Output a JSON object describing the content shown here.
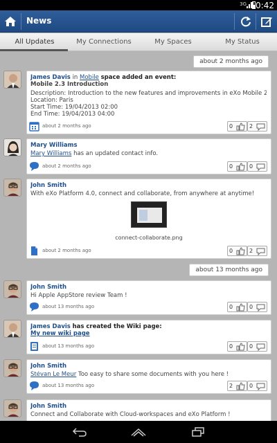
{
  "status_bar": {
    "signal": "3G",
    "time": "10:42"
  },
  "action_bar": {
    "title": "News"
  },
  "tabs": [
    {
      "label": "All Updates",
      "active": true
    },
    {
      "label": "My Connections"
    },
    {
      "label": "My Spaces"
    },
    {
      "label": "My Status"
    }
  ],
  "groups": [
    {
      "header": "about 2 months ago"
    },
    {
      "header": "about 13 months ago"
    }
  ],
  "posts": [
    {
      "author": "James Davis",
      "connector": "in",
      "space": "Mobile",
      "action": "space added an event:",
      "event_title": "Mobile 2.3 Introduction",
      "description": "Description: Introduction to the new features and improvements in eXo Mobile 2.3",
      "location": "Location: Paris",
      "start": "Start Time: 19/04/2013 02:00",
      "end": "End Time: 19/04/2013 04:00",
      "time": "about 2 months ago",
      "icon": "calendar-icon",
      "likes": "0",
      "comments": "2"
    },
    {
      "author": "Mary Williams",
      "link": "Mary Williams",
      "text": "has an updated contact info.",
      "time": "about 2 months ago",
      "icon": "comment-bubble-icon",
      "likes": "0",
      "comments": "0"
    },
    {
      "author": "John Smith",
      "text": "With eXo Platform 4.0, connect and collaborate, from anywhere at anytime!",
      "attachment": "connect-collaborate.png",
      "time": "about 2 months ago",
      "icon": "document-icon",
      "likes": "0",
      "comments": "2"
    },
    {
      "author": "John Smith",
      "text": "Hi Apple AppStore review Team !",
      "time": "about 13 months ago",
      "icon": "comment-bubble-icon",
      "likes": "0",
      "comments": "0"
    },
    {
      "author": "James Davis",
      "action": "has created the Wiki page:",
      "link": "My new wiki page",
      "time": "about 13 months ago",
      "icon": "wiki-page-icon",
      "likes": "0",
      "comments": "0"
    },
    {
      "author": "John Smith",
      "link": "Stévan Le Meur",
      "text": "Too easy to share some documents with you here !",
      "time": "about 13 months ago",
      "icon": "comment-bubble-icon",
      "likes": "2",
      "comments": "0"
    },
    {
      "author": "John Smith",
      "text": "Connect and Collaborate with Cloud-workspaces and eXo Platform !"
    }
  ],
  "colors": {
    "action_bar": "#2a5592",
    "link": "#1e4f8c",
    "icon_blue": "#2f6fc4"
  }
}
